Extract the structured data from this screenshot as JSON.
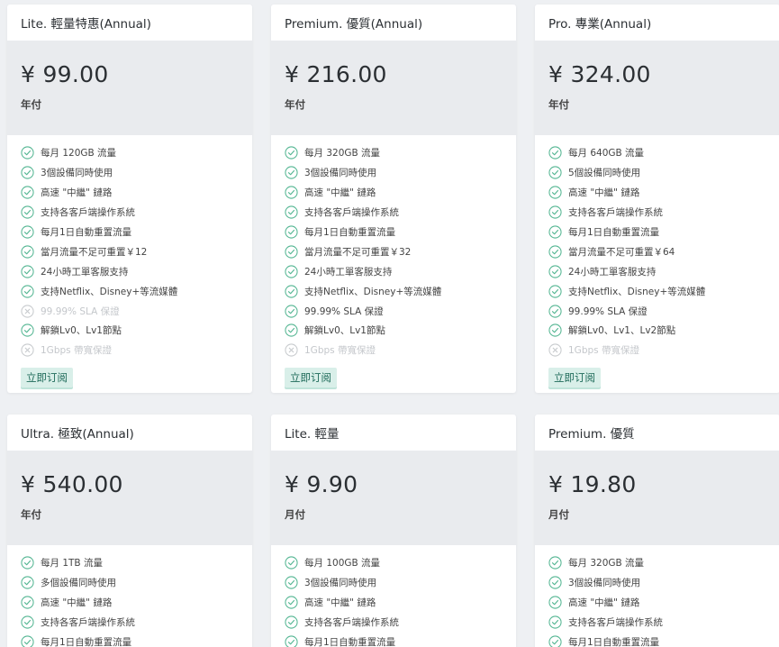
{
  "colors": {
    "check": "#52b591",
    "check_off": "#c7cacd",
    "button_bg": "#d9efe9",
    "button_text": "#1f6b5a"
  },
  "plans": [
    {
      "title": "Lite. 輕量特惠(Annual)",
      "price": "¥ 99.00",
      "period": "年付",
      "button": "立即订阅",
      "features": [
        {
          "text": "每月 120GB 流量",
          "on": true
        },
        {
          "text": "3個設備同時使用",
          "on": true
        },
        {
          "text": "高速 \"中繼\" 鏈路",
          "on": true
        },
        {
          "text": "支持各客戶端操作系統",
          "on": true
        },
        {
          "text": "每月1日自動重置流量",
          "on": true
        },
        {
          "text": "當月流量不足可重置￥12",
          "on": true
        },
        {
          "text": "24小時工單客服支持",
          "on": true
        },
        {
          "text": "支持Netflix、Disney+等流媒體",
          "on": true
        },
        {
          "text": "99.99% SLA 保證",
          "on": false
        },
        {
          "text": "解鎖Lv0、Lv1節點",
          "on": true
        },
        {
          "text": "1Gbps 帶寬保證",
          "on": false
        }
      ]
    },
    {
      "title": "Premium. 優質(Annual)",
      "price": "¥ 216.00",
      "period": "年付",
      "button": "立即订阅",
      "features": [
        {
          "text": "每月 320GB 流量",
          "on": true
        },
        {
          "text": "3個設備同時使用",
          "on": true
        },
        {
          "text": "高速 \"中繼\" 鏈路",
          "on": true
        },
        {
          "text": "支持各客戶端操作系統",
          "on": true
        },
        {
          "text": "每月1日自動重置流量",
          "on": true
        },
        {
          "text": "當月流量不足可重置￥32",
          "on": true
        },
        {
          "text": "24小時工單客服支持",
          "on": true
        },
        {
          "text": "支持Netflix、Disney+等流媒體",
          "on": true
        },
        {
          "text": "99.99% SLA 保證",
          "on": true
        },
        {
          "text": "解鎖Lv0、Lv1節點",
          "on": true
        },
        {
          "text": "1Gbps 帶寬保證",
          "on": false
        }
      ]
    },
    {
      "title": "Pro. 專業(Annual)",
      "price": "¥ 324.00",
      "period": "年付",
      "button": "立即订阅",
      "features": [
        {
          "text": "每月 640GB 流量",
          "on": true
        },
        {
          "text": "5個設備同時使用",
          "on": true
        },
        {
          "text": "高速 \"中繼\" 鏈路",
          "on": true
        },
        {
          "text": "支持各客戶端操作系統",
          "on": true
        },
        {
          "text": "每月1日自動重置流量",
          "on": true
        },
        {
          "text": "當月流量不足可重置￥64",
          "on": true
        },
        {
          "text": "24小時工單客服支持",
          "on": true
        },
        {
          "text": "支持Netflix、Disney+等流媒體",
          "on": true
        },
        {
          "text": "99.99% SLA 保證",
          "on": true
        },
        {
          "text": "解鎖Lv0、Lv1、Lv2節點",
          "on": true
        },
        {
          "text": "1Gbps 帶寬保證",
          "on": false
        }
      ]
    },
    {
      "title": "Ultra. 極致(Annual)",
      "price": "¥ 540.00",
      "period": "年付",
      "features": [
        {
          "text": "每月 1TB 流量",
          "on": true
        },
        {
          "text": "多個設備同時使用",
          "on": true
        },
        {
          "text": "高速 \"中繼\" 鏈路",
          "on": true
        },
        {
          "text": "支持各客戶端操作系統",
          "on": true
        },
        {
          "text": "每月1日自動重置流量",
          "on": true
        }
      ]
    },
    {
      "title": "Lite. 輕量",
      "price": "¥ 9.90",
      "period": "月付",
      "features": [
        {
          "text": "每月 100GB 流量",
          "on": true
        },
        {
          "text": "3個設備同時使用",
          "on": true
        },
        {
          "text": "高速 \"中繼\" 鏈路",
          "on": true
        },
        {
          "text": "支持各客戶端操作系統",
          "on": true
        },
        {
          "text": "每月1日自動重置流量",
          "on": true
        }
      ]
    },
    {
      "title": "Premium. 優質",
      "price": "¥ 19.80",
      "period": "月付",
      "features": [
        {
          "text": "每月 320GB 流量",
          "on": true
        },
        {
          "text": "3個設備同時使用",
          "on": true
        },
        {
          "text": "高速 \"中繼\" 鏈路",
          "on": true
        },
        {
          "text": "支持各客戶端操作系統",
          "on": true
        },
        {
          "text": "每月1日自動重置流量",
          "on": true
        }
      ]
    }
  ]
}
